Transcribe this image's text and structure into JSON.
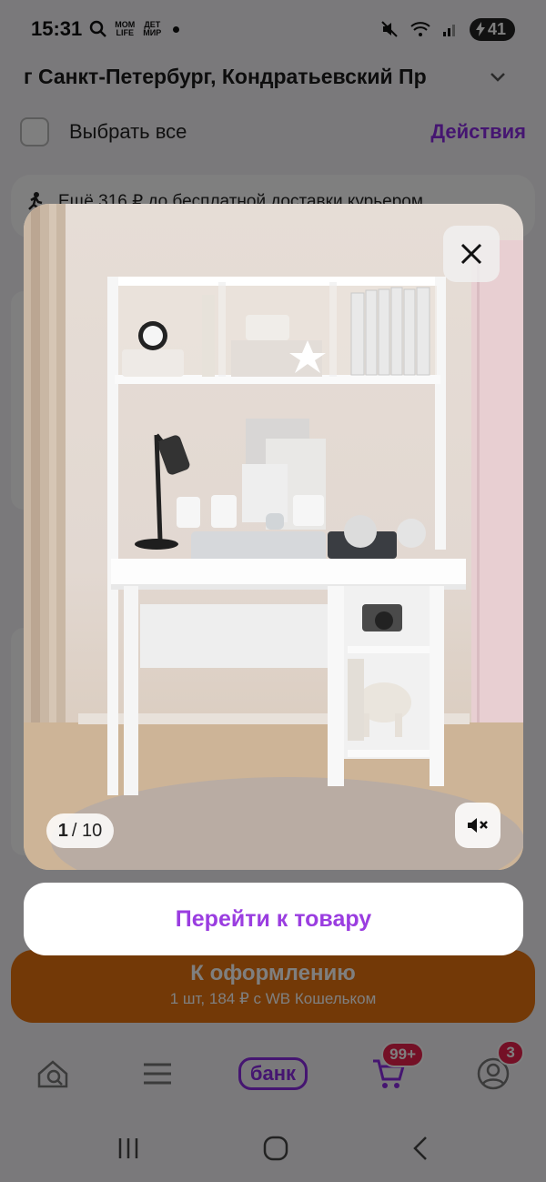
{
  "status_bar": {
    "time": "15:31",
    "mini_icon_1": "MOM\nLIFE",
    "mini_icon_2": "ДЕТ\nМИР",
    "battery": "41",
    "icons": [
      "search-icon",
      "mute-icon",
      "wifi-icon",
      "signal-icon",
      "battery-icon"
    ]
  },
  "header": {
    "address": "г Санкт-Петербург, Кондратьевский Пр"
  },
  "select_row": {
    "select_all_label": "Выбрать все",
    "actions_label": "Действия"
  },
  "delivery_banner": {
    "text": "Ещё 316 ₽ до бесплатной доставки курьером"
  },
  "checkout": {
    "title": "К оформлению",
    "subtitle": "1 шт, 184 ₽ с WB Кошельком",
    "color": "#e7730f"
  },
  "tab_bar": {
    "bank_label": "банк",
    "cart_badge": "99+",
    "profile_badge": "3",
    "accent": "#8a2be2",
    "badge_color": "#e8204c"
  },
  "media_viewer": {
    "counter_current": "1",
    "counter_total": "/ 10",
    "goto_label": "Перейти к товару",
    "goto_color": "#9a3de0"
  }
}
